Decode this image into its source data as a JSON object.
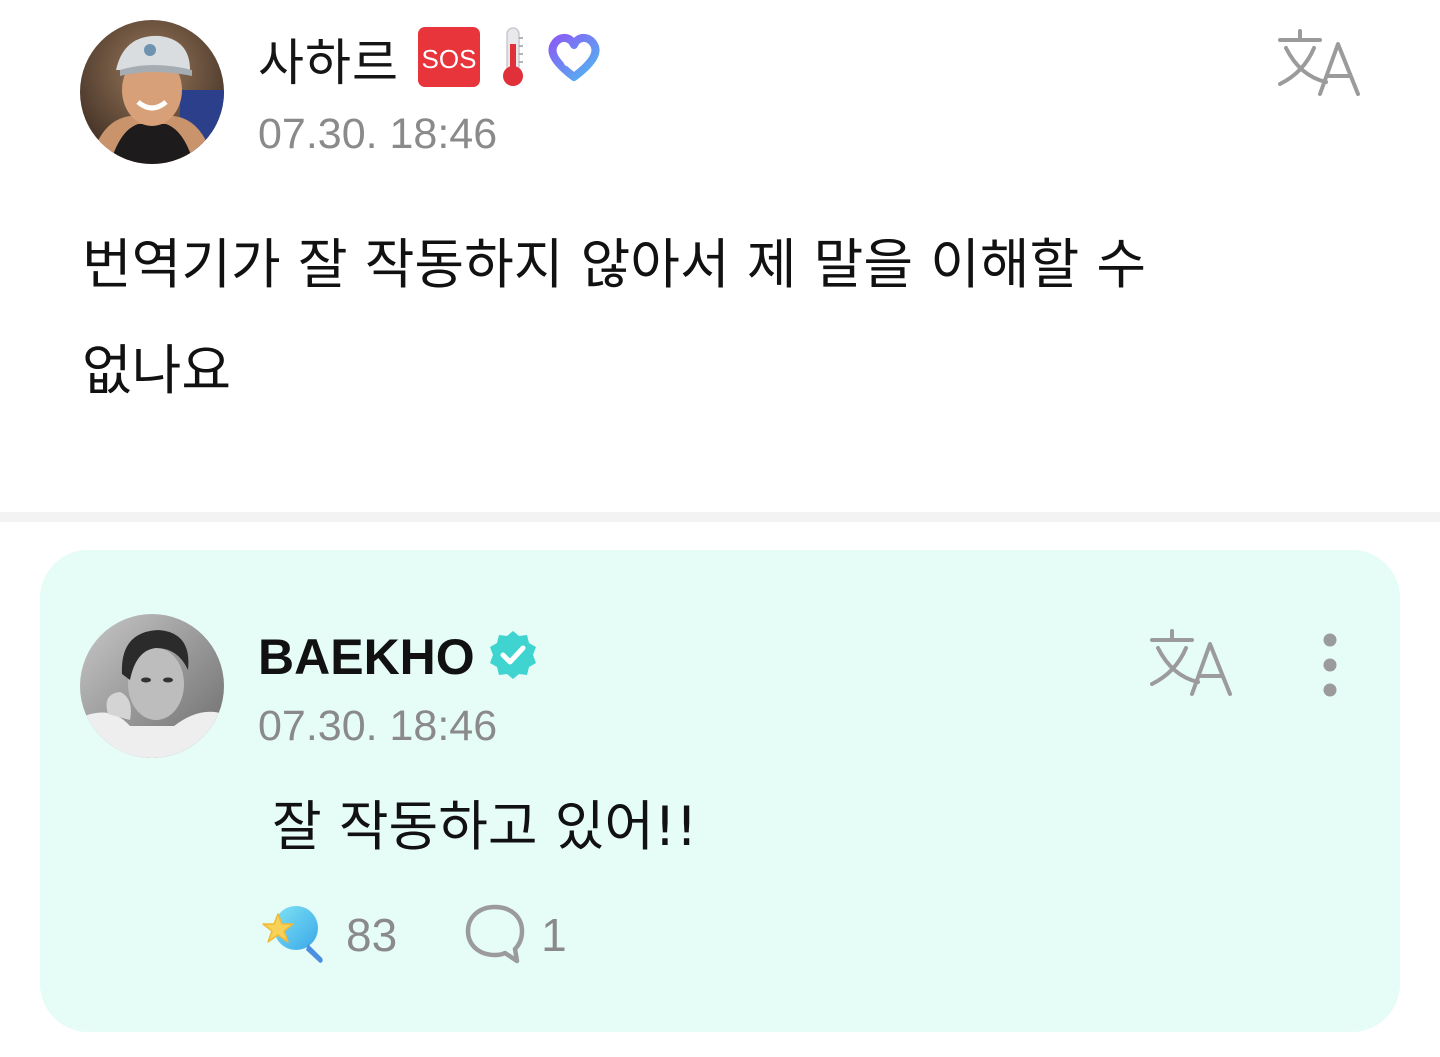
{
  "post": {
    "author": {
      "name": "사하르",
      "badges": [
        "sos-icon",
        "thermometer-icon",
        "heart-ribbon-icon"
      ],
      "avatar": "user-avatar"
    },
    "timestamp": "07.30. 18:46",
    "body_line1": "번역기가 잘 작동하지 않아서 제 말을 이해할 수",
    "body_line2": "없나요",
    "sos_text": "SOS",
    "translate_icon": "translate-icon"
  },
  "reply": {
    "author": {
      "name": "BAEKHO",
      "verified": true,
      "avatar": "artist-avatar"
    },
    "timestamp": "07.30. 18:46",
    "text": "잘 작동하고 있어!!",
    "like_count": "83",
    "comment_count": "1",
    "icons": [
      "translate-icon",
      "more-vertical-icon",
      "star-wand-icon",
      "comment-icon"
    ]
  },
  "colors": {
    "reply_background": "#e6fcf7",
    "verified_badge": "#3fd4cf",
    "timestamp": "#8a8a8a",
    "divider": "#f3f3f3",
    "sos_red": "#e8353b"
  }
}
